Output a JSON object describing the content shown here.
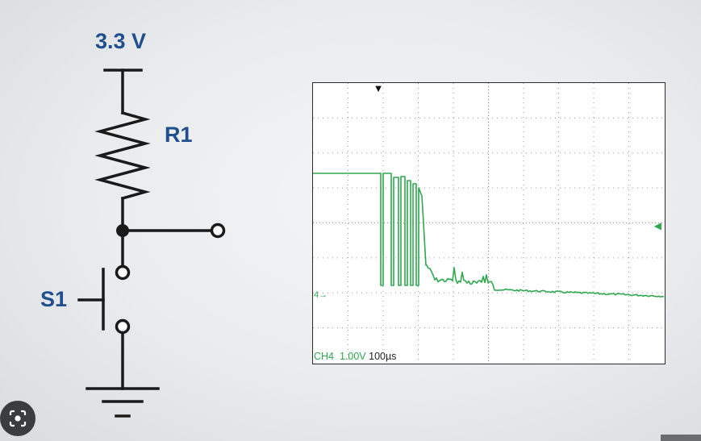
{
  "circuit": {
    "supply_label": "3.3 V",
    "resistor_label": "R1",
    "switch_label": "S1",
    "wire_color": "#1a1a1a",
    "label_color": "#1f4f8f"
  },
  "scope": {
    "channel": "CH4",
    "volts_per_div": "1.00V",
    "time_per_div": "100µs",
    "trace_color": "#2fa84f",
    "ground_marker": "4→",
    "trigger_marker": "▼",
    "level_marker": "◀"
  },
  "overlay": {
    "lens_icon": "visual-search-icon"
  }
}
